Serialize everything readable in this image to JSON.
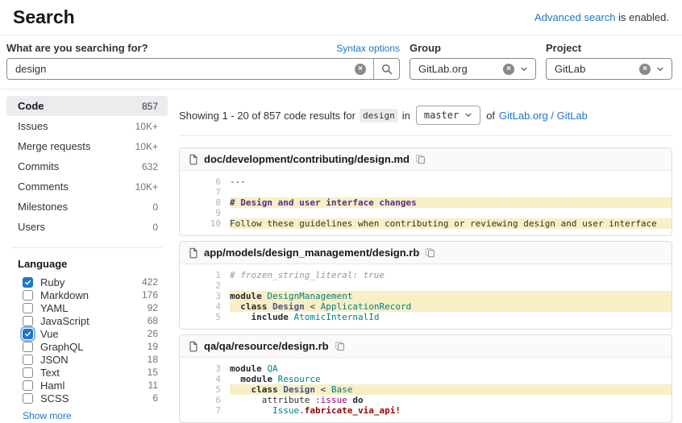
{
  "page": {
    "title": "Search"
  },
  "header": {
    "advanced_link": "Advanced search",
    "advanced_suffix": " is enabled."
  },
  "search_form": {
    "query_label": "What are you searching for?",
    "syntax_options": "Syntax options",
    "query_value": "design",
    "group_label": "Group",
    "group_value": "GitLab.org",
    "project_label": "Project",
    "project_value": "GitLab"
  },
  "sidebar": {
    "scopes": [
      {
        "label": "Code",
        "count": "857",
        "active": true
      },
      {
        "label": "Issues",
        "count": "10K+",
        "active": false
      },
      {
        "label": "Merge requests",
        "count": "10K+",
        "active": false
      },
      {
        "label": "Commits",
        "count": "632",
        "active": false
      },
      {
        "label": "Comments",
        "count": "10K+",
        "active": false
      },
      {
        "label": "Milestones",
        "count": "0",
        "active": false
      },
      {
        "label": "Users",
        "count": "0",
        "active": false
      }
    ],
    "language": {
      "title": "Language",
      "items": [
        {
          "label": "Ruby",
          "count": "422",
          "checked": true,
          "focused": false
        },
        {
          "label": "Markdown",
          "count": "176",
          "checked": false,
          "focused": false
        },
        {
          "label": "YAML",
          "count": "92",
          "checked": false,
          "focused": false
        },
        {
          "label": "JavaScript",
          "count": "68",
          "checked": false,
          "focused": false
        },
        {
          "label": "Vue",
          "count": "26",
          "checked": true,
          "focused": true
        },
        {
          "label": "GraphQL",
          "count": "19",
          "checked": false,
          "focused": false
        },
        {
          "label": "JSON",
          "count": "18",
          "checked": false,
          "focused": false
        },
        {
          "label": "Text",
          "count": "15",
          "checked": false,
          "focused": false
        },
        {
          "label": "Haml",
          "count": "11",
          "checked": false,
          "focused": false
        },
        {
          "label": "SCSS",
          "count": "6",
          "checked": false,
          "focused": false
        }
      ],
      "show_more": "Show more"
    }
  },
  "results": {
    "summary": {
      "prefix": "Showing 1 - 20 of 857 code results for",
      "term": "design",
      "in_word": "in",
      "branch": "master",
      "of_word": "of",
      "project_link": "GitLab.org / GitLab"
    },
    "files": [
      {
        "path": "doc/development/contributing/design.md",
        "lines": [
          {
            "n": "6",
            "hl": false,
            "tokens": [
              {
                "t": "---",
                "c": "plain"
              }
            ]
          },
          {
            "n": "7",
            "hl": false,
            "tokens": []
          },
          {
            "n": "8",
            "hl": true,
            "tokens": [
              {
                "t": "# Design and user interface changes",
                "c": "heading"
              }
            ]
          },
          {
            "n": "9",
            "hl": false,
            "tokens": []
          },
          {
            "n": "10",
            "hl": true,
            "tokens": [
              {
                "t": "Follow these guidelines when contributing or reviewing design and user interface",
                "c": "plain"
              }
            ]
          }
        ]
      },
      {
        "path": "app/models/design_management/design.rb",
        "lines": [
          {
            "n": "1",
            "hl": false,
            "tokens": [
              {
                "t": "# frozen_string_literal: true",
                "c": "comment"
              }
            ]
          },
          {
            "n": "2",
            "hl": false,
            "tokens": []
          },
          {
            "n": "3",
            "hl": true,
            "tokens": [
              {
                "t": "module",
                "c": "kw"
              },
              {
                "t": " ",
                "c": "plain"
              },
              {
                "t": "DesignManagement",
                "c": "const"
              }
            ]
          },
          {
            "n": "4",
            "hl": true,
            "tokens": [
              {
                "t": "  ",
                "c": "plain"
              },
              {
                "t": "class",
                "c": "kw"
              },
              {
                "t": " ",
                "c": "plain"
              },
              {
                "t": "Design",
                "c": "classname"
              },
              {
                "t": " < ",
                "c": "plain"
              },
              {
                "t": "ApplicationRecord",
                "c": "const"
              }
            ]
          },
          {
            "n": "5",
            "hl": false,
            "tokens": [
              {
                "t": "    ",
                "c": "plain"
              },
              {
                "t": "include",
                "c": "kw"
              },
              {
                "t": " ",
                "c": "plain"
              },
              {
                "t": "AtomicInternalId",
                "c": "const"
              }
            ]
          }
        ]
      },
      {
        "path": "qa/qa/resource/design.rb",
        "lines": [
          {
            "n": "3",
            "hl": false,
            "tokens": [
              {
                "t": "module",
                "c": "kw"
              },
              {
                "t": " ",
                "c": "plain"
              },
              {
                "t": "QA",
                "c": "const"
              }
            ]
          },
          {
            "n": "4",
            "hl": false,
            "tokens": [
              {
                "t": "  ",
                "c": "plain"
              },
              {
                "t": "module",
                "c": "kw"
              },
              {
                "t": " ",
                "c": "plain"
              },
              {
                "t": "Resource",
                "c": "const"
              }
            ]
          },
          {
            "n": "5",
            "hl": true,
            "tokens": [
              {
                "t": "    ",
                "c": "plain"
              },
              {
                "t": "class",
                "c": "kw"
              },
              {
                "t": " ",
                "c": "plain"
              },
              {
                "t": "Design",
                "c": "classname"
              },
              {
                "t": " < ",
                "c": "plain"
              },
              {
                "t": "Base",
                "c": "const"
              }
            ]
          },
          {
            "n": "6",
            "hl": false,
            "tokens": [
              {
                "t": "      attribute ",
                "c": "plain"
              },
              {
                "t": ":issue",
                "c": "symbol"
              },
              {
                "t": " ",
                "c": "plain"
              },
              {
                "t": "do",
                "c": "kw"
              }
            ]
          },
          {
            "n": "7",
            "hl": false,
            "tokens": [
              {
                "t": "        ",
                "c": "plain"
              },
              {
                "t": "Issue",
                "c": "const"
              },
              {
                "t": ".",
                "c": "plain"
              },
              {
                "t": "fabricate_via_api!",
                "c": "method"
              }
            ]
          }
        ]
      }
    ]
  },
  "colors": {
    "link_blue": "#1f75cb",
    "checkbox_blue": "#1f75cb",
    "highlight_yellow": "#f8efc7",
    "active_scope_bg": "#ececef"
  },
  "icons": [
    "search-icon",
    "clear-icon",
    "chevron-down-icon",
    "file-icon",
    "copy-icon",
    "checkbox-check-icon"
  ]
}
